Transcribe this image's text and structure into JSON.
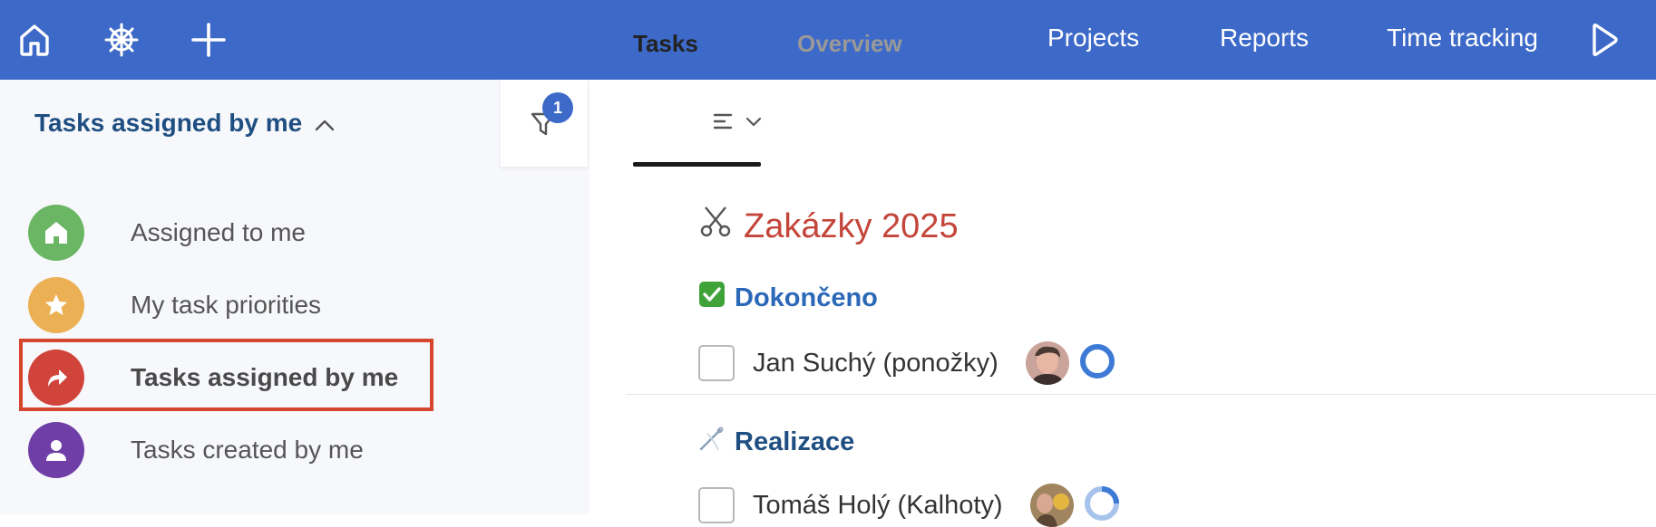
{
  "topbar": {
    "icons": [
      "home-icon",
      "wheel-icon",
      "plus-icon",
      "play-icon"
    ],
    "nav": [
      "Projects",
      "Reports",
      "Time tracking"
    ],
    "background": "#3d69c8"
  },
  "sidebar": {
    "header": "Tasks assigned by me",
    "items": [
      {
        "label": "Assigned to me",
        "icon": "home-icon",
        "color": "#6ab664"
      },
      {
        "label": "My task priorities",
        "icon": "star-icon",
        "color": "#ecb054"
      },
      {
        "label": "Tasks assigned by me",
        "icon": "forward-arrow-icon",
        "color": "#d1443b",
        "active": true
      },
      {
        "label": "Tasks created by me",
        "icon": "person-icon",
        "color": "#6f3ea6"
      }
    ]
  },
  "filter": {
    "badge": "1"
  },
  "tabs": {
    "items": [
      {
        "label": "Tasks",
        "active": true
      },
      {
        "label": "Overview",
        "active": false
      }
    ]
  },
  "main": {
    "project_title": "Zakázky 2025",
    "project_icon": "scissors-icon",
    "sections": [
      {
        "title": "Dokončeno",
        "icon": "check-mark-icon",
        "tasks": [
          {
            "name": "Jan Suchý (ponožky)"
          }
        ]
      },
      {
        "title": "Realizace",
        "icon": "needle-icon",
        "tasks": [
          {
            "name": "Tomáš Holý (Kalhoty)"
          }
        ]
      }
    ]
  }
}
